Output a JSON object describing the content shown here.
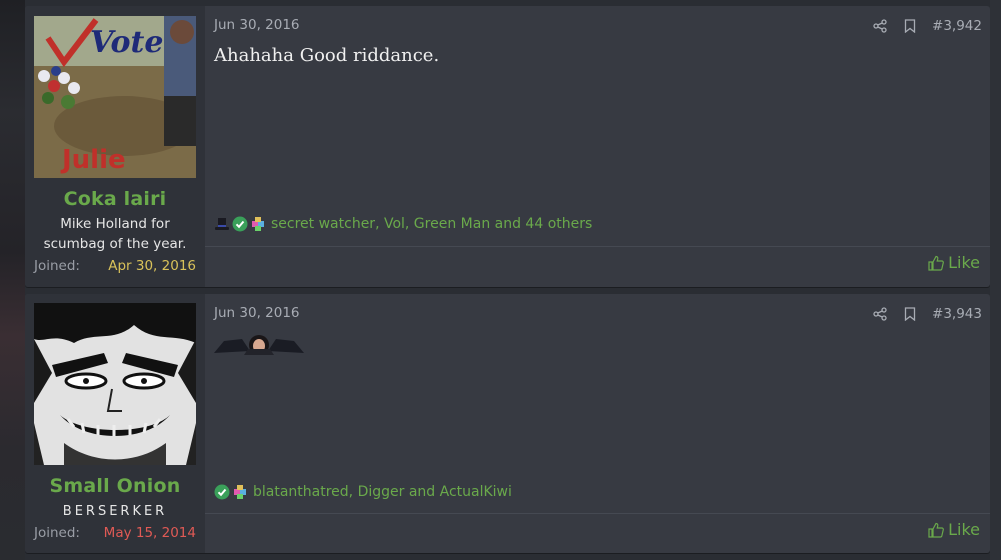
{
  "posts": [
    {
      "date": "Jun 30, 2016",
      "post_number": "#3,942",
      "message": "Ahahaha Good riddance.",
      "user": {
        "name": "Coka lairi",
        "title": "Mike Holland for scumbag of the year.",
        "joined_label": "Joined:",
        "joined_date": "Apr 30, 2016",
        "avatar_text_top": "Vote",
        "avatar_text_bottom": "Julie"
      },
      "reactions": {
        "icons": [
          "top-hat-icon",
          "check-badge-icon",
          "puzzle-icon"
        ],
        "text": "secret watcher, Vol, Green Man and 44 others"
      },
      "like_label": "Like"
    },
    {
      "date": "Jun 30, 2016",
      "post_number": "#3,943",
      "user": {
        "name": "Small Onion",
        "title": "BERSERKER",
        "joined_label": "Joined:",
        "joined_date": "May 15, 2014"
      },
      "reactions": {
        "icons": [
          "check-badge-icon",
          "puzzle-icon"
        ],
        "text": "blatanthatred, Digger and ActualKiwi"
      },
      "like_label": "Like"
    }
  ],
  "colors": {
    "username": "#6aa94b",
    "joined_date_1": "#d9c25a",
    "joined_date_2": "#e05a55",
    "link": "#6aa94b"
  }
}
